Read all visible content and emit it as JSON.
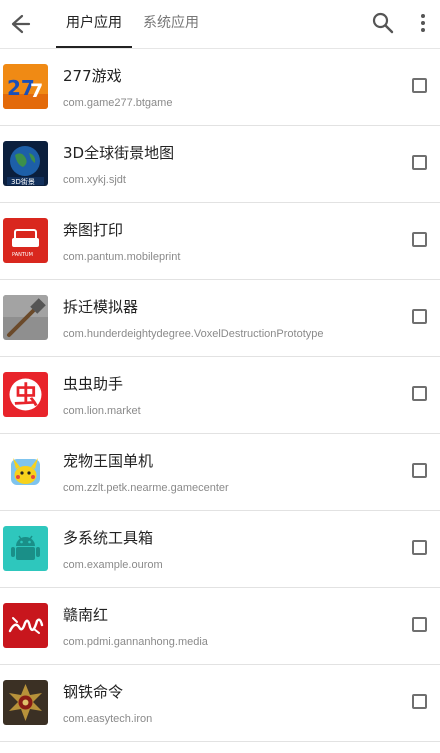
{
  "tabs": [
    {
      "label": "用户应用",
      "active": true
    },
    {
      "label": "系统应用",
      "active": false
    }
  ],
  "icons": {
    "back": "arrow-left-icon",
    "search": "search-icon",
    "more": "more-vert-icon"
  },
  "apps": [
    {
      "name": "277游戏",
      "package": "com.game277.btgame",
      "icon": "app-277-icon",
      "checked": false
    },
    {
      "name": "3D全球街景地图",
      "package": "com.xykj.sjdt",
      "icon": "earth-3d-icon",
      "checked": false
    },
    {
      "name": "奔图打印",
      "package": "com.pantum.mobileprint",
      "icon": "printer-icon",
      "checked": false
    },
    {
      "name": "拆迁模拟器",
      "package": "com.hunderdeightydegree.VoxelDestructionPrototype",
      "icon": "hammer-icon",
      "checked": false
    },
    {
      "name": "虫虫助手",
      "package": "com.lion.market",
      "icon": "bug-char-icon",
      "checked": false
    },
    {
      "name": "宠物王国单机",
      "package": "com.zzlt.petk.nearme.gamecenter",
      "icon": "pet-pikachu-icon",
      "checked": false
    },
    {
      "name": "多系统工具箱",
      "package": "com.example.ourom",
      "icon": "android-robot-icon",
      "checked": false
    },
    {
      "name": "赣南红",
      "package": "com.pdmi.gannanhong.media",
      "icon": "calligraphy-icon",
      "checked": false
    },
    {
      "name": "钢铁命令",
      "package": "com.easytech.iron",
      "icon": "iron-emblem-icon",
      "checked": false
    }
  ]
}
